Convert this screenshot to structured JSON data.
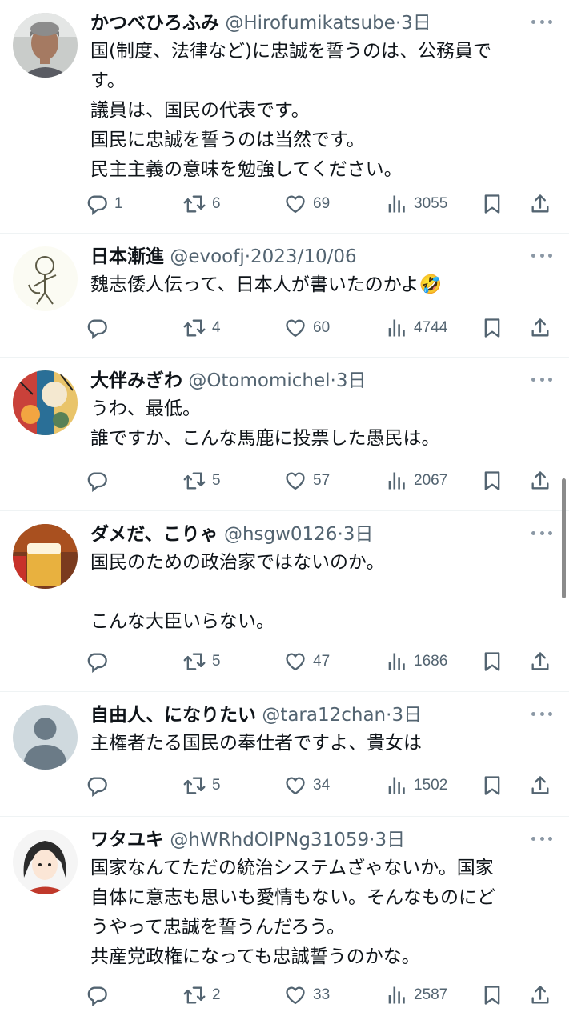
{
  "tweets": [
    {
      "name": "かつべひろふみ",
      "handle": "@Hirofumikatsube",
      "sep": "·",
      "date": "3日",
      "lines": [
        "国(制度、法律など)に忠誠を誓うのは、公務員で",
        "す。",
        "議員は、国民の代表です。",
        "国民に忠誠を誓うのは当然です。",
        "民主主義の意味を勉強してください。"
      ],
      "replies": "1",
      "retweets": "6",
      "likes": "69",
      "views": "3055",
      "avatar": "photo-man-grey-hair"
    },
    {
      "name": "日本漸進",
      "handle": "@evoofj",
      "sep": "·",
      "date": "2023/10/06",
      "lines": [
        "魏志倭人伝って、日本人が書いたのかよ🤣"
      ],
      "replies": "",
      "retweets": "4",
      "likes": "60",
      "views": "4744",
      "avatar": "stick-figure-drawing"
    },
    {
      "name": "大伴みぎわ",
      "handle": "@Otomomichel",
      "sep": "·",
      "date": "3日",
      "lines": [
        "うわ、最低。",
        "誰ですか、こんな馬鹿に投票した愚民は。"
      ],
      "replies": "",
      "retweets": "5",
      "likes": "57",
      "views": "2067",
      "avatar": "colorful-illustration"
    },
    {
      "name": "ダメだ、こりゃ",
      "handle": "@hsgw0126",
      "sep": "·",
      "date": "3日",
      "lines": [
        "国民のための政治家ではないのか。",
        "",
        "こんな大臣いらない。"
      ],
      "replies": "",
      "retweets": "5",
      "likes": "47",
      "views": "1686",
      "avatar": "beer-glass-photo"
    },
    {
      "name": "自由人、になりたい",
      "handle": "@tara12chan",
      "sep": "·",
      "date": "3日",
      "lines": [
        "主権者たる国民の奉仕者ですよ、貴女は"
      ],
      "replies": "",
      "retweets": "5",
      "likes": "34",
      "views": "1502",
      "avatar": "default-profile"
    },
    {
      "name": "ワタユキ",
      "handle": "@hWRhdOlPNg31059",
      "sep": "·",
      "date": "3日",
      "lines": [
        "国家なんてただの統治システムざゃないか。国家",
        "自体に意志も思いも愛情もない。そんなものにど",
        "うやって忠誠を誓うんだろう。",
        "共産党政権になっても忠誠誓うのかな。"
      ],
      "replies": "",
      "retweets": "2",
      "likes": "33",
      "views": "2587",
      "avatar": "anime-girl-illustration"
    }
  ],
  "colors": {
    "text": "#0f1419",
    "secondary": "#536471",
    "divider": "#eff3f4",
    "more_dots": "#8b98a5"
  },
  "icons": [
    "reply-icon",
    "retweet-icon",
    "like-icon",
    "views-icon",
    "bookmark-icon",
    "share-icon",
    "more-icon"
  ]
}
